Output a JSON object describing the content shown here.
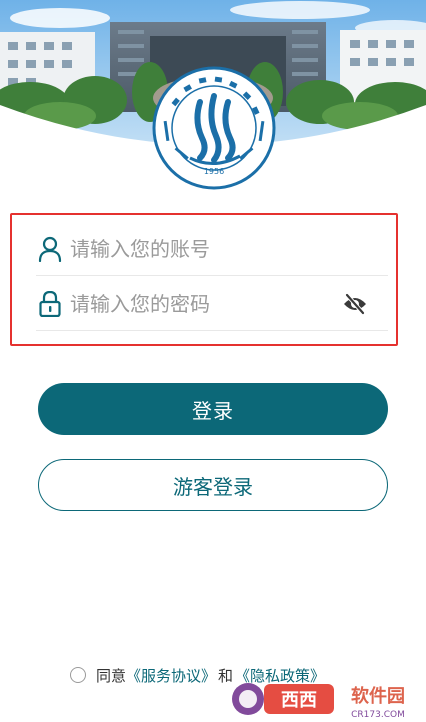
{
  "header": {
    "photo": "campus-building-photo"
  },
  "logo": {
    "name": "college-emblem",
    "year": "1956",
    "colors": {
      "primary": "#1b6fa8"
    }
  },
  "login": {
    "account_placeholder": "请输入您的账号",
    "password_placeholder": "请输入您的密码",
    "account_icon": "user-icon",
    "password_icon": "lock-icon",
    "visibility_icon": "eye-off-icon"
  },
  "buttons": {
    "login_label": "登录",
    "guest_label": "游客登录"
  },
  "agreement": {
    "prefix": "同意",
    "service_link": "《服务协议》",
    "conjunction": "和",
    "privacy_link": "《隐私政策》"
  },
  "watermark": {
    "brand": "西西",
    "suffix": "软件园",
    "domain": "CR173.COM"
  },
  "colors": {
    "accent": "#0c6878",
    "highlight_border": "#e5312f",
    "placeholder": "#9a9a9a"
  }
}
